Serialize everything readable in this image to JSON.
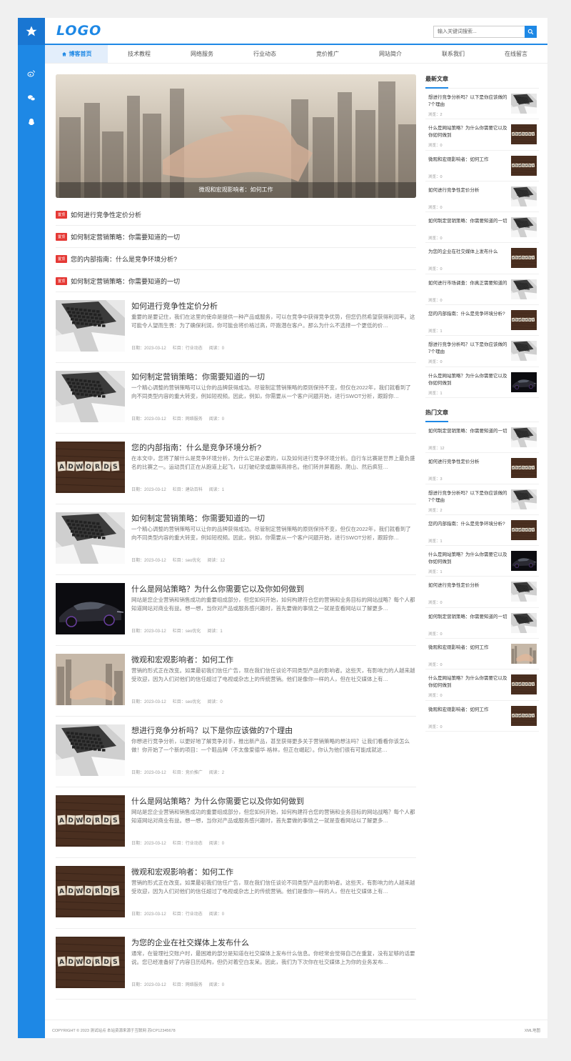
{
  "brand": {
    "logo": "LOGO",
    "accent": "#1e88e5"
  },
  "search": {
    "placeholder": "输入关键词搜索..."
  },
  "nav": [
    "博客首页",
    "技术教程",
    "网络服务",
    "行业动态",
    "竞价推广",
    "网站简介",
    "联系我们",
    "在线留言"
  ],
  "banner": {
    "caption": "微观和宏观影响者：如何工作"
  },
  "headlines": {
    "tag": "置顶",
    "items": [
      "如何进行竞争性定价分析",
      "如何制定营销策略：你需要知道的一切",
      "您的内部指南：什么是竞争环境分析?",
      "如何制定营销策略：你需要知道的一切"
    ]
  },
  "posts": [
    {
      "title": "如何进行竞争性定价分析",
      "excerpt": "重要的是要记住，我们在这里的使命是提供一种产品或服务，可以在竞争中获得竞争优势，但您仍然希望获得利润率。这可能令人望而生畏：为了确保利润，你可能会将价格过高，吓跑潜在客户。那么为什么不选择一个更低的价…",
      "date": "日期：2023-03-12",
      "cat": "栏目：行业动态",
      "views": "阅读：0",
      "img": "laptop"
    },
    {
      "title": "如何制定营销策略：你需要知道的一切",
      "excerpt": "一个精心调整的营销策略可以让你的品牌获得成功。尽管制定营销策略的原则保持不变，但仅在2022年，我们就看到了向不同类型内容的重大转变，例如短视频。因此，例如，你需要从一个客户问题开始，进行SWOT分析，跟踪你…",
      "date": "日期：2023-03-12",
      "cat": "栏目：网络服务",
      "views": "阅读：0",
      "img": "laptop"
    },
    {
      "title": "您的内部指南：什么是竞争环境分析?",
      "excerpt": "在本文中，您将了解什么是竞争环境分析，为什么它是必要的，以及如何进行竞争环境分析。自行车比赛是世界上最负盛名的比赛之一。运动员们正在从跑道上起飞，以打破纪录或赢得高排名。他们转并屏着跑、爬山、然后疯狂…",
      "date": "日期：2023-03-12",
      "cat": "栏目：建站百科",
      "views": "阅读：1",
      "img": "adwords"
    },
    {
      "title": "如何制定营销策略：你需要知道的一切",
      "excerpt": "一个精心调整的营销策略可以让你的品牌获得成功。尽管制定营销策略的原则保持不变，但仅在2022年，我们就看到了向不同类型内容的重大转变，例如短视频。因此，例如，你需要从一个客户问题开始，进行SWOT分析，跟踪你…",
      "date": "日期：2023-03-12",
      "cat": "栏目：seo优化",
      "views": "阅读：12",
      "img": "laptop"
    },
    {
      "title": "什么是网站策略？为什么你需要它以及你如何做到",
      "excerpt": "网站是您企业营销和销售成功的重要组成部分，但您如何开始，如何构建符合您的营销和业务目标的网站战略？每个人都知道网站对商业有益。想一想，当你对产品或服务感兴趣时，首先要做的事情之一就是查看网站以了解更多…",
      "date": "日期：2023-03-12",
      "cat": "栏目：seo优化",
      "views": "阅读：1",
      "img": "car"
    },
    {
      "title": "微观和宏观影响者：如何工作",
      "excerpt": "营销的形式正在改变。如果最初我们信任广告，现在我们信任谈论不同类型产品的影响者。这些天，有影响力的人越来越受欢迎，因为人们对他们的信任超过了电视或杂志上的传统营销。他们是像你一样的人，但在社交媒体上有…",
      "date": "日期：2023-03-12",
      "cat": "栏目：seo优化",
      "views": "阅读：0",
      "img": "handshake"
    },
    {
      "title": "想进行竞争分析吗？以下是你应该做的7个理由",
      "excerpt": "你想进行竞争分析，以更好地了解竞争对手，推出新产品，甚至获得更多关于营销策略的想法吗？让我们看看你该怎么做！你开始了一个新的项目：一个鞋品牌（不太像爱德华·格林，但正在崛起）。你认为他们很有可能成就这…",
      "date": "日期：2023-03-12",
      "cat": "栏目：竞价推广",
      "views": "阅读：2",
      "img": "laptop"
    },
    {
      "title": "什么是网站策略？为什么你需要它以及你如何做到",
      "excerpt": "网站是您企业营销和销售成功的重要组成部分，但您如何开始，如何构建符合您的营销和业务目标的网站战略？每个人都知道网站对商业有益。想一想，当你对产品或服务感兴趣时，首先要做的事情之一就是查看网站以了解更多…",
      "date": "日期：2023-03-12",
      "cat": "栏目：行业动态",
      "views": "阅读：0",
      "img": "adwords"
    },
    {
      "title": "微观和宏观影响者：如何工作",
      "excerpt": "营销的形式正在改变。如果最初我们信任广告，现在我们信任谈论不同类型产品的影响者。这些天，有影响力的人越来越受欢迎，因为人们对他们的信任超过了电视或杂志上的传统营销。他们是像你一样的人，但在社交媒体上有…",
      "date": "日期：2023-03-12",
      "cat": "栏目：行业动态",
      "views": "阅读：0",
      "img": "adwords"
    },
    {
      "title": "为您的企业在社交媒体上发布什么",
      "excerpt": "通常，在管理社交账户时，最困难的部分是知道在社交媒体上发布什么信息。你经常会觉得自己在重复，没有足够的话要说。您已经准备好了内容日历结构，但仍对着空白发呆。因此，我们为下次你在社交媒体上为你的业务发布…",
      "date": "日期：2023-03-12",
      "cat": "栏目：网络服务",
      "views": "阅读：0",
      "img": "adwords"
    }
  ],
  "latest": {
    "title": "最新文章",
    "items": [
      {
        "t": "想进行竞争分析吗？以下是你应该做的7个理由",
        "v": "浏览：2",
        "img": "laptop"
      },
      {
        "t": "什么是网站策略？为什么你需要它以及你如何做到",
        "v": "浏览：0",
        "img": "adwords"
      },
      {
        "t": "微观和宏观影响者：如何工作",
        "v": "浏览：0",
        "img": "adwords"
      },
      {
        "t": "如何进行竞争性定价分析",
        "v": "浏览：0",
        "img": "laptop"
      },
      {
        "t": "如何制定营销策略：你需要知道的一切",
        "v": "浏览：0",
        "img": "laptop"
      },
      {
        "t": "为您的企业在社交媒体上发布什么",
        "v": "浏览：0",
        "img": "adwords"
      },
      {
        "t": "如何进行市场调查：你真正需要知道的",
        "v": "浏览：0",
        "img": "laptop"
      },
      {
        "t": "您的内部指南：什么是竞争环境分析?",
        "v": "浏览：1",
        "img": "adwords"
      },
      {
        "t": "想进行竞争分析吗？以下是你应该做的7个理由",
        "v": "浏览：0",
        "img": "laptop"
      },
      {
        "t": "什么是网站策略？为什么你需要它以及你如何做到",
        "v": "浏览：1",
        "img": "car"
      }
    ]
  },
  "hot": {
    "title": "热门文章",
    "items": [
      {
        "t": "如何制定营销策略：你需要知道的一切",
        "v": "浏览：12",
        "img": "laptop"
      },
      {
        "t": "如何进行竞争性定价分析",
        "v": "浏览：3",
        "img": "adwords"
      },
      {
        "t": "想进行竞争分析吗？以下是你应该做的7个理由",
        "v": "浏览：2",
        "img": "laptop"
      },
      {
        "t": "您的内部指南：什么是竞争环境分析?",
        "v": "浏览：1",
        "img": "adwords"
      },
      {
        "t": "什么是网站策略？为什么你需要它以及你如何做到",
        "v": "浏览：1",
        "img": "car"
      },
      {
        "t": "如何进行竞争性定价分析",
        "v": "浏览：0",
        "img": "laptop"
      },
      {
        "t": "如何制定营销策略：你需要知道的一切",
        "v": "浏览：0",
        "img": "laptop"
      },
      {
        "t": "微观和宏观影响者：如何工作",
        "v": "浏览：0",
        "img": "handshake"
      },
      {
        "t": "什么是网站策略？为什么你需要它以及你如何做到",
        "v": "浏览：0",
        "img": "adwords"
      },
      {
        "t": "微观和宏观影响者：如何工作",
        "v": "浏览：0",
        "img": "adwords"
      }
    ]
  },
  "footer": {
    "copyright": "COPYRIGHT © 2023 测试站点 本站资源来源于互联网 苏ICP12345678",
    "xml": "XML地图"
  }
}
